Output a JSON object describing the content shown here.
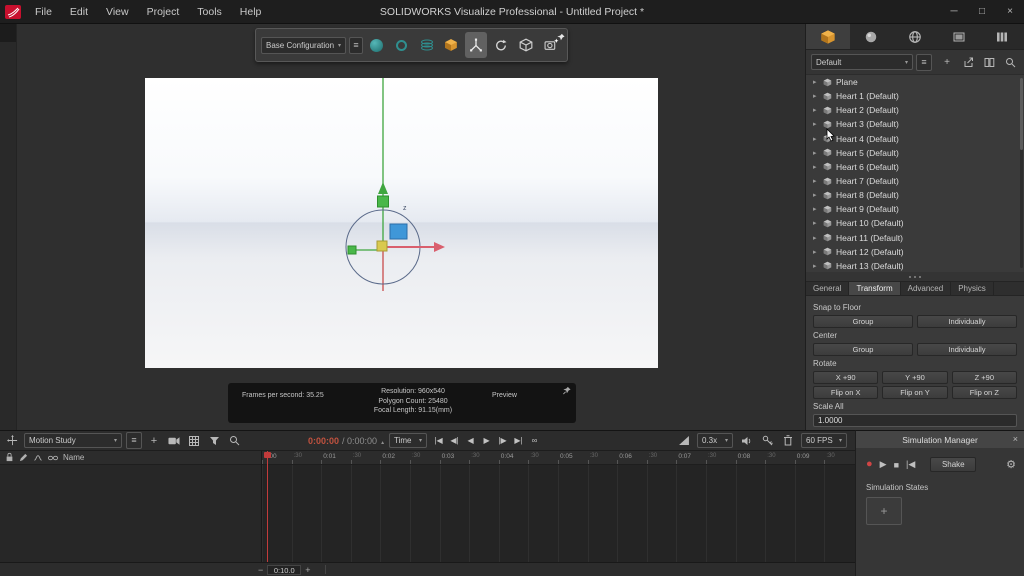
{
  "app": {
    "title": "SOLIDWORKS Visualize Professional - Untitled Project *"
  },
  "menubar": {
    "menus": [
      "File",
      "Edit",
      "View",
      "Project",
      "Tools",
      "Help"
    ],
    "window_controls": [
      {
        "name": "minimize",
        "glyph": "─"
      },
      {
        "name": "maximize",
        "glyph": "□"
      },
      {
        "name": "close",
        "glyph": "×"
      }
    ]
  },
  "main_toolbar": {
    "configuration": "Base Configuration"
  },
  "viewport": {
    "axis_label": "z",
    "stats": {
      "fps": "Frames per second: 35.25",
      "resolution": "Resolution: 960x540",
      "polygons": "Polygon Count: 25480",
      "focal": "Focal Length: 91.15(mm)",
      "mode": "Preview"
    }
  },
  "scene_panel": {
    "collection": "Default",
    "items": [
      "Plane",
      "Heart 1 (Default)",
      "Heart 2 (Default)",
      "Heart 3 (Default)",
      "Heart 4 (Default)",
      "Heart 5 (Default)",
      "Heart 6 (Default)",
      "Heart 7 (Default)",
      "Heart 8 (Default)",
      "Heart 9 (Default)",
      "Heart 10 (Default)",
      "Heart 11 (Default)",
      "Heart 12 (Default)",
      "Heart 13 (Default)"
    ],
    "tabs": [
      "General",
      "Transform",
      "Advanced",
      "Physics"
    ],
    "active_tab": "Transform",
    "transform": {
      "snap_label": "Snap to Floor",
      "center_label": "Center",
      "rotate_label": "Rotate",
      "scale_label": "Scale All",
      "group": "Group",
      "individually": "Individually",
      "rotate_buttons": [
        "X +90",
        "Y +90",
        "Z +90"
      ],
      "flip_buttons": [
        "Flip on X",
        "Flip on Y",
        "Flip on Z"
      ],
      "scale_value": "1.0000"
    }
  },
  "timeline": {
    "study": "Motion Study",
    "current_time": "0:00:00",
    "total_time": "/ 0:00:00",
    "mode": "Time",
    "speed": "0.3x",
    "fps": "60 FPS",
    "name_header": "Name",
    "transport": [
      {
        "name": "go-to-start",
        "glyph": "|◀"
      },
      {
        "name": "step-back",
        "glyph": "◀|"
      },
      {
        "name": "play-backward",
        "glyph": "◀"
      },
      {
        "name": "play",
        "glyph": "▶"
      },
      {
        "name": "step-forward",
        "glyph": "|▶"
      },
      {
        "name": "go-to-end",
        "glyph": "▶|"
      },
      {
        "name": "loop",
        "glyph": "∞"
      }
    ],
    "ruler": [
      "0:00",
      ":30",
      "0:01",
      ":30",
      "0:02",
      ":30",
      "0:03",
      ":30",
      "0:04",
      ":30",
      "0:05",
      ":30",
      "0:06",
      ":30",
      "0:07",
      ":30",
      "0:08",
      ":30",
      "0:09",
      ":30"
    ],
    "zoom": {
      "minus": "−",
      "value": "0:10.0",
      "plus": "+"
    }
  },
  "simulation": {
    "title": "Simulation Manager",
    "controls": [
      {
        "name": "record",
        "glyph": "●"
      },
      {
        "name": "play",
        "glyph": "▶"
      },
      {
        "name": "stop",
        "glyph": "■"
      },
      {
        "name": "skip-to-start",
        "glyph": "|◀"
      }
    ],
    "shake": "Shake",
    "states_label": "Simulation States",
    "add": "+"
  },
  "glyphs": {
    "tree_arrow": "▸",
    "dropdown": "▾",
    "hamburger": "≡",
    "plus": "+",
    "gear": "⚙",
    "up": "▲"
  },
  "colors": {
    "accent_orange": "#e0962e",
    "playhead_red": "#c23b3b",
    "record_red": "#d04545",
    "teal": "#2f8f8f"
  }
}
